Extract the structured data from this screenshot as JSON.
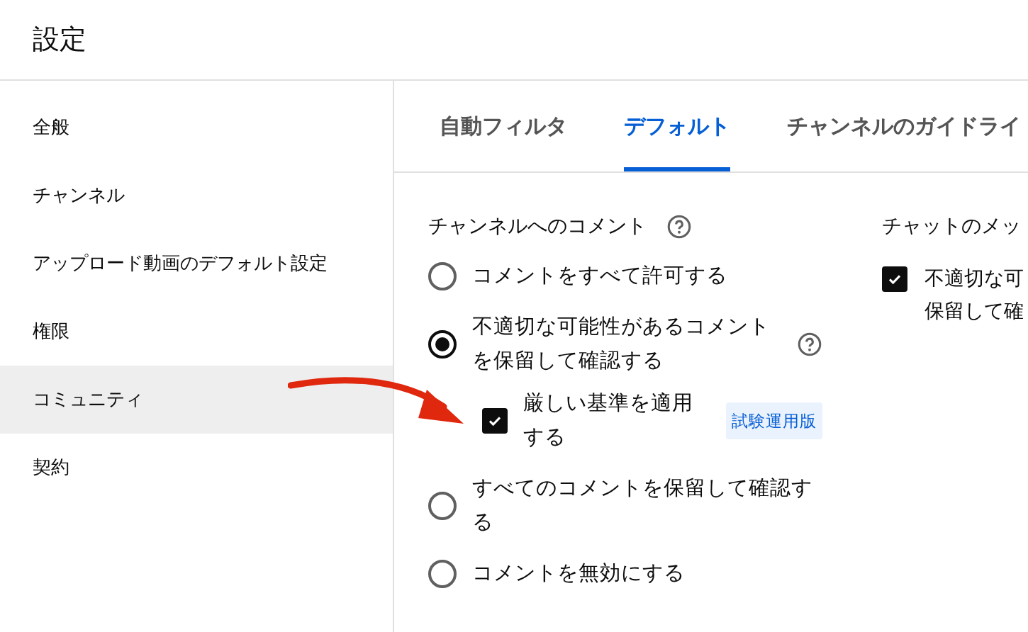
{
  "header": {
    "title": "設定"
  },
  "sidebar": {
    "items": [
      {
        "label": "全般",
        "selected": false
      },
      {
        "label": "チャンネル",
        "selected": false
      },
      {
        "label": "アップロード動画のデフォルト設定",
        "selected": false
      },
      {
        "label": "権限",
        "selected": false
      },
      {
        "label": "コミュニティ",
        "selected": true
      },
      {
        "label": "契約",
        "selected": false
      }
    ]
  },
  "tabs": [
    {
      "label": "自動フィルタ",
      "selected": false
    },
    {
      "label": "デフォルト",
      "selected": true
    },
    {
      "label": "チャンネルのガイドライ",
      "selected": false
    }
  ],
  "comments": {
    "title": "チャンネルへのコメント",
    "help": true,
    "options": [
      {
        "kind": "radio",
        "label": "コメントをすべて許可する",
        "selected": false
      },
      {
        "kind": "radio",
        "label": "不適切な可能性があるコメントを保留して確認する",
        "selected": true,
        "help": true,
        "sub": {
          "label": "厳しい基準を適用する",
          "checked": true,
          "badge": "試験運用版"
        }
      },
      {
        "kind": "radio",
        "label": "すべてのコメントを保留して確認する",
        "selected": false
      },
      {
        "kind": "radio",
        "label": "コメントを無効にする",
        "selected": false
      }
    ]
  },
  "chat": {
    "title": "チャットのメッ",
    "option": {
      "lines": [
        "不適切な可",
        "保留して確"
      ],
      "checked": true
    }
  }
}
